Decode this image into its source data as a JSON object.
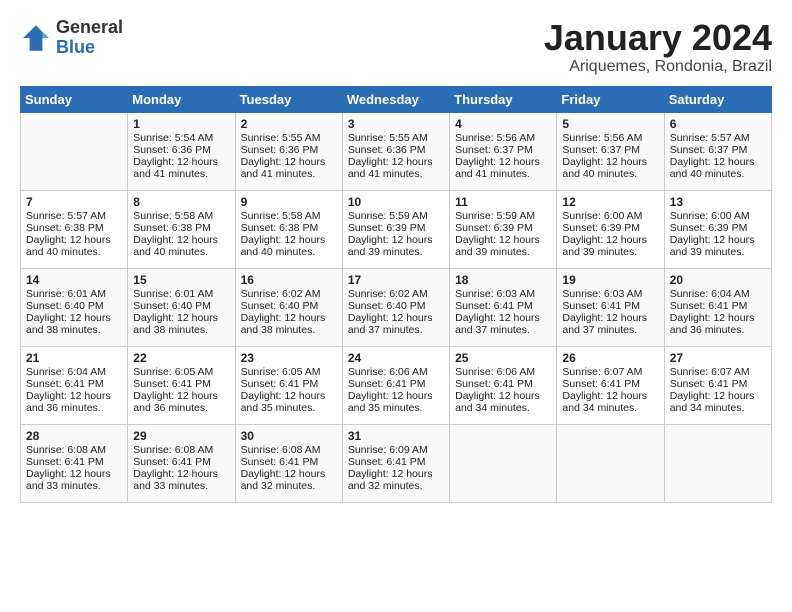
{
  "logo": {
    "general": "General",
    "blue": "Blue"
  },
  "header": {
    "title": "January 2024",
    "subtitle": "Ariquemes, Rondonia, Brazil"
  },
  "days": [
    "Sunday",
    "Monday",
    "Tuesday",
    "Wednesday",
    "Thursday",
    "Friday",
    "Saturday"
  ],
  "weeks": [
    [
      {
        "day": "",
        "content": ""
      },
      {
        "day": "1",
        "content": "Sunrise: 5:54 AM\nSunset: 6:36 PM\nDaylight: 12 hours\nand 41 minutes."
      },
      {
        "day": "2",
        "content": "Sunrise: 5:55 AM\nSunset: 6:36 PM\nDaylight: 12 hours\nand 41 minutes."
      },
      {
        "day": "3",
        "content": "Sunrise: 5:55 AM\nSunset: 6:36 PM\nDaylight: 12 hours\nand 41 minutes."
      },
      {
        "day": "4",
        "content": "Sunrise: 5:56 AM\nSunset: 6:37 PM\nDaylight: 12 hours\nand 41 minutes."
      },
      {
        "day": "5",
        "content": "Sunrise: 5:56 AM\nSunset: 6:37 PM\nDaylight: 12 hours\nand 40 minutes."
      },
      {
        "day": "6",
        "content": "Sunrise: 5:57 AM\nSunset: 6:37 PM\nDaylight: 12 hours\nand 40 minutes."
      }
    ],
    [
      {
        "day": "7",
        "content": "Sunrise: 5:57 AM\nSunset: 6:38 PM\nDaylight: 12 hours\nand 40 minutes."
      },
      {
        "day": "8",
        "content": "Sunrise: 5:58 AM\nSunset: 6:38 PM\nDaylight: 12 hours\nand 40 minutes."
      },
      {
        "day": "9",
        "content": "Sunrise: 5:58 AM\nSunset: 6:38 PM\nDaylight: 12 hours\nand 40 minutes."
      },
      {
        "day": "10",
        "content": "Sunrise: 5:59 AM\nSunset: 6:39 PM\nDaylight: 12 hours\nand 39 minutes."
      },
      {
        "day": "11",
        "content": "Sunrise: 5:59 AM\nSunset: 6:39 PM\nDaylight: 12 hours\nand 39 minutes."
      },
      {
        "day": "12",
        "content": "Sunrise: 6:00 AM\nSunset: 6:39 PM\nDaylight: 12 hours\nand 39 minutes."
      },
      {
        "day": "13",
        "content": "Sunrise: 6:00 AM\nSunset: 6:39 PM\nDaylight: 12 hours\nand 39 minutes."
      }
    ],
    [
      {
        "day": "14",
        "content": "Sunrise: 6:01 AM\nSunset: 6:40 PM\nDaylight: 12 hours\nand 38 minutes."
      },
      {
        "day": "15",
        "content": "Sunrise: 6:01 AM\nSunset: 6:40 PM\nDaylight: 12 hours\nand 38 minutes."
      },
      {
        "day": "16",
        "content": "Sunrise: 6:02 AM\nSunset: 6:40 PM\nDaylight: 12 hours\nand 38 minutes."
      },
      {
        "day": "17",
        "content": "Sunrise: 6:02 AM\nSunset: 6:40 PM\nDaylight: 12 hours\nand 37 minutes."
      },
      {
        "day": "18",
        "content": "Sunrise: 6:03 AM\nSunset: 6:41 PM\nDaylight: 12 hours\nand 37 minutes."
      },
      {
        "day": "19",
        "content": "Sunrise: 6:03 AM\nSunset: 6:41 PM\nDaylight: 12 hours\nand 37 minutes."
      },
      {
        "day": "20",
        "content": "Sunrise: 6:04 AM\nSunset: 6:41 PM\nDaylight: 12 hours\nand 36 minutes."
      }
    ],
    [
      {
        "day": "21",
        "content": "Sunrise: 6:04 AM\nSunset: 6:41 PM\nDaylight: 12 hours\nand 36 minutes."
      },
      {
        "day": "22",
        "content": "Sunrise: 6:05 AM\nSunset: 6:41 PM\nDaylight: 12 hours\nand 36 minutes."
      },
      {
        "day": "23",
        "content": "Sunrise: 6:05 AM\nSunset: 6:41 PM\nDaylight: 12 hours\nand 35 minutes."
      },
      {
        "day": "24",
        "content": "Sunrise: 6:06 AM\nSunset: 6:41 PM\nDaylight: 12 hours\nand 35 minutes."
      },
      {
        "day": "25",
        "content": "Sunrise: 6:06 AM\nSunset: 6:41 PM\nDaylight: 12 hours\nand 34 minutes."
      },
      {
        "day": "26",
        "content": "Sunrise: 6:07 AM\nSunset: 6:41 PM\nDaylight: 12 hours\nand 34 minutes."
      },
      {
        "day": "27",
        "content": "Sunrise: 6:07 AM\nSunset: 6:41 PM\nDaylight: 12 hours\nand 34 minutes."
      }
    ],
    [
      {
        "day": "28",
        "content": "Sunrise: 6:08 AM\nSunset: 6:41 PM\nDaylight: 12 hours\nand 33 minutes."
      },
      {
        "day": "29",
        "content": "Sunrise: 6:08 AM\nSunset: 6:41 PM\nDaylight: 12 hours\nand 33 minutes."
      },
      {
        "day": "30",
        "content": "Sunrise: 6:08 AM\nSunset: 6:41 PM\nDaylight: 12 hours\nand 32 minutes."
      },
      {
        "day": "31",
        "content": "Sunrise: 6:09 AM\nSunset: 6:41 PM\nDaylight: 12 hours\nand 32 minutes."
      },
      {
        "day": "",
        "content": ""
      },
      {
        "day": "",
        "content": ""
      },
      {
        "day": "",
        "content": ""
      }
    ]
  ]
}
